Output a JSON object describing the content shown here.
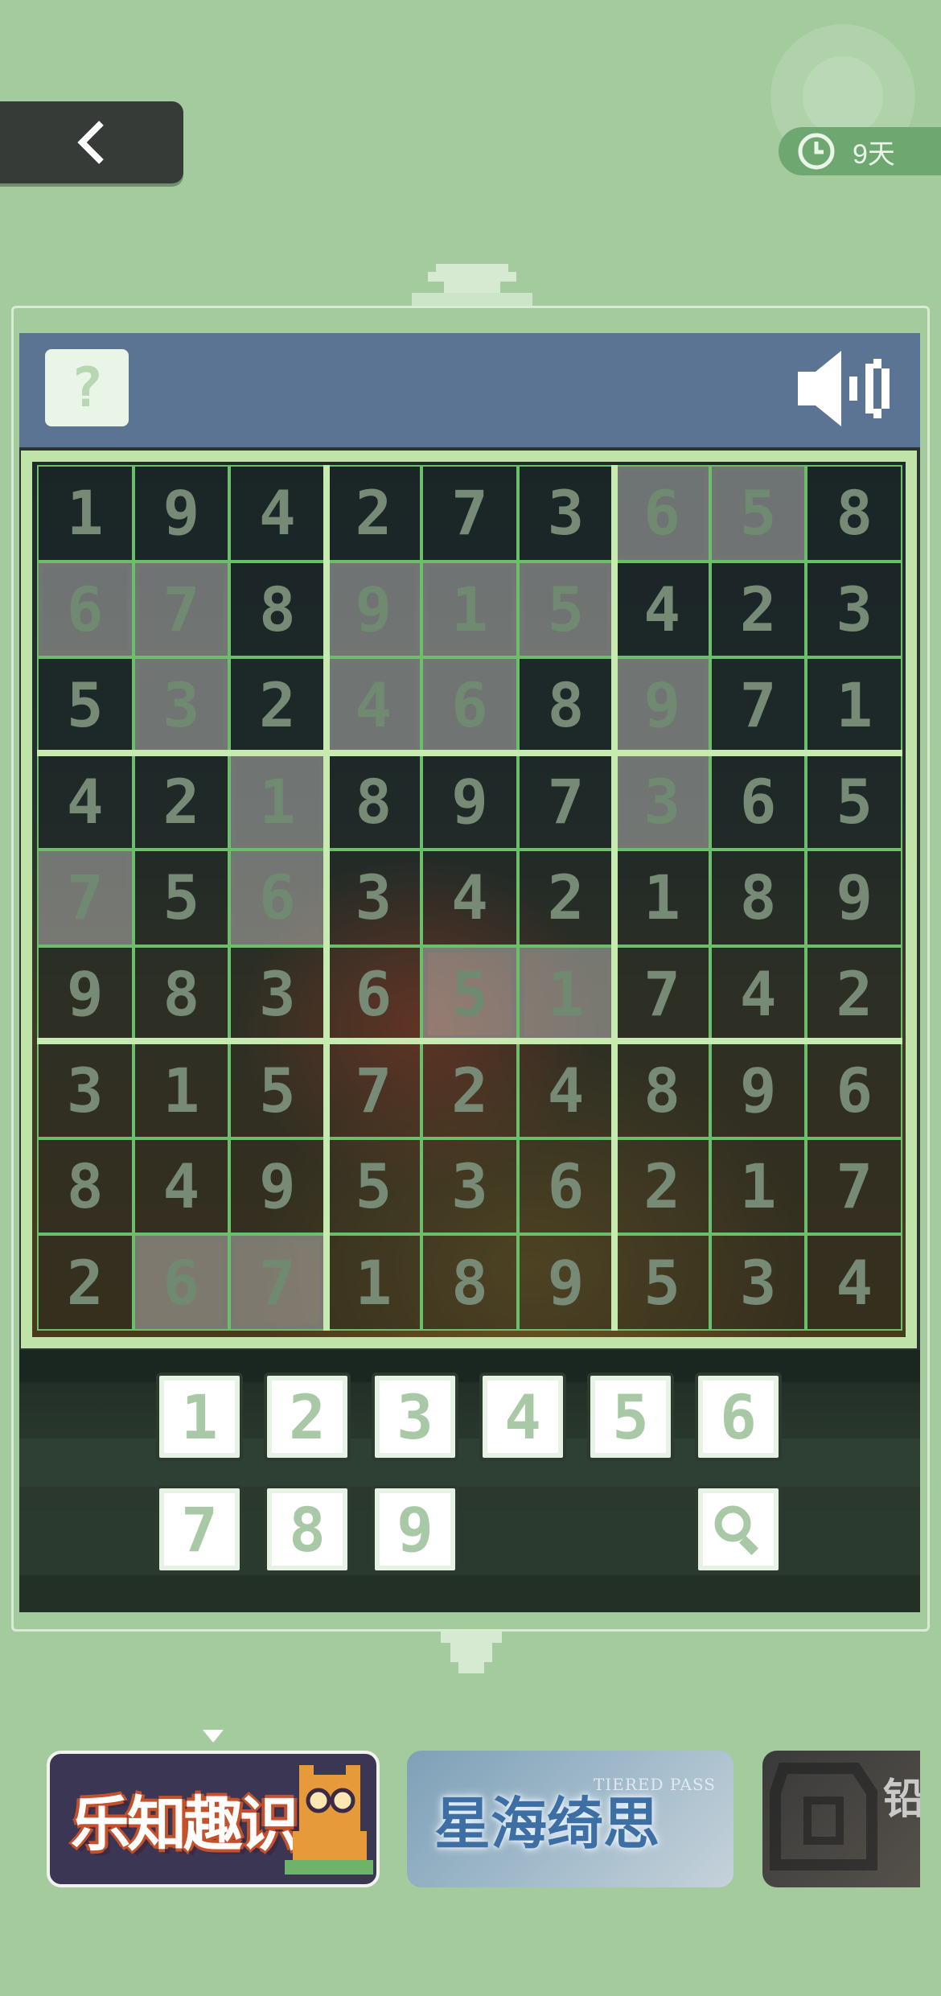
{
  "topbar": {
    "back_icon": "chevron-left-icon",
    "timer_icon": "clock-icon",
    "timer_text": "9天"
  },
  "header": {
    "help_label": "?",
    "sound_icon": "speaker-icon"
  },
  "board": {
    "rows": [
      [
        1,
        9,
        4,
        2,
        7,
        3,
        6,
        5,
        8
      ],
      [
        6,
        7,
        8,
        9,
        1,
        5,
        4,
        2,
        3
      ],
      [
        5,
        3,
        2,
        4,
        6,
        8,
        9,
        7,
        1
      ],
      [
        4,
        2,
        1,
        8,
        9,
        7,
        3,
        6,
        5
      ],
      [
        7,
        5,
        6,
        3,
        4,
        2,
        1,
        8,
        9
      ],
      [
        9,
        8,
        3,
        6,
        5,
        1,
        7,
        4,
        2
      ],
      [
        3,
        1,
        5,
        7,
        2,
        4,
        8,
        9,
        6
      ],
      [
        8,
        4,
        9,
        5,
        3,
        6,
        2,
        1,
        7
      ],
      [
        2,
        6,
        7,
        1,
        8,
        9,
        5,
        3,
        4
      ]
    ],
    "highlighted": [
      [
        0,
        6
      ],
      [
        0,
        7
      ],
      [
        1,
        0
      ],
      [
        1,
        1
      ],
      [
        1,
        3
      ],
      [
        1,
        4
      ],
      [
        1,
        5
      ],
      [
        2,
        1
      ],
      [
        2,
        3
      ],
      [
        2,
        4
      ],
      [
        2,
        6
      ],
      [
        3,
        2
      ],
      [
        3,
        6
      ],
      [
        4,
        0
      ],
      [
        4,
        2
      ],
      [
        5,
        4
      ],
      [
        5,
        5
      ],
      [
        8,
        1
      ],
      [
        8,
        2
      ]
    ]
  },
  "keypad": {
    "keys": [
      "1",
      "2",
      "3",
      "4",
      "5",
      "6",
      "7",
      "8",
      "9"
    ],
    "hint_icon": "magnifier-icon"
  },
  "carousel": {
    "cards": [
      {
        "title": "乐知趣识"
      },
      {
        "title": "星海绮思",
        "subtitle": "TIERED PASS"
      },
      {
        "title": "铅"
      }
    ]
  }
}
